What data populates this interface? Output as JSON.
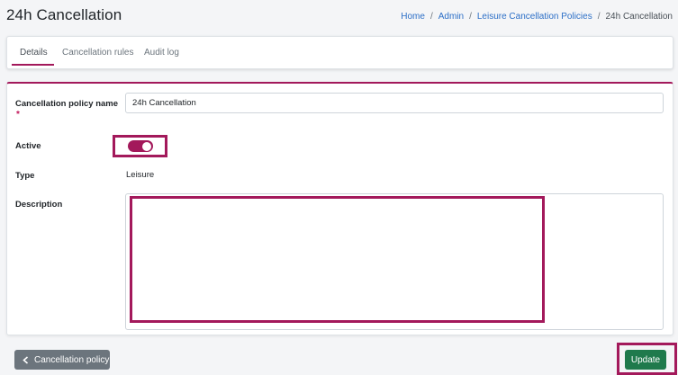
{
  "page": {
    "title": "24h Cancellation"
  },
  "breadcrumb": {
    "items": [
      "Home",
      "Admin",
      "Leisure Cancellation Policies"
    ],
    "current": "24h Cancellation",
    "separator": "/"
  },
  "tabs": [
    {
      "label": "Details",
      "active": true
    },
    {
      "label": "Cancellation rules",
      "active": false
    },
    {
      "label": "Audit log",
      "active": false
    }
  ],
  "form": {
    "name_label": "Cancellation policy name",
    "required_mark": "*",
    "name_value": "24h Cancellation",
    "active_label": "Active",
    "active_on": true,
    "type_label": "Type",
    "type_value": "Leisure",
    "description_label": "Description",
    "description_value": ""
  },
  "footer": {
    "back_label": "Cancellation policy",
    "back_icon": "chevron-left-icon",
    "update_label": "Update"
  },
  "colors": {
    "accent": "#a3195b",
    "link": "#2c6fc7",
    "update_button": "#1f7a4c",
    "back_button": "#6c757d"
  }
}
